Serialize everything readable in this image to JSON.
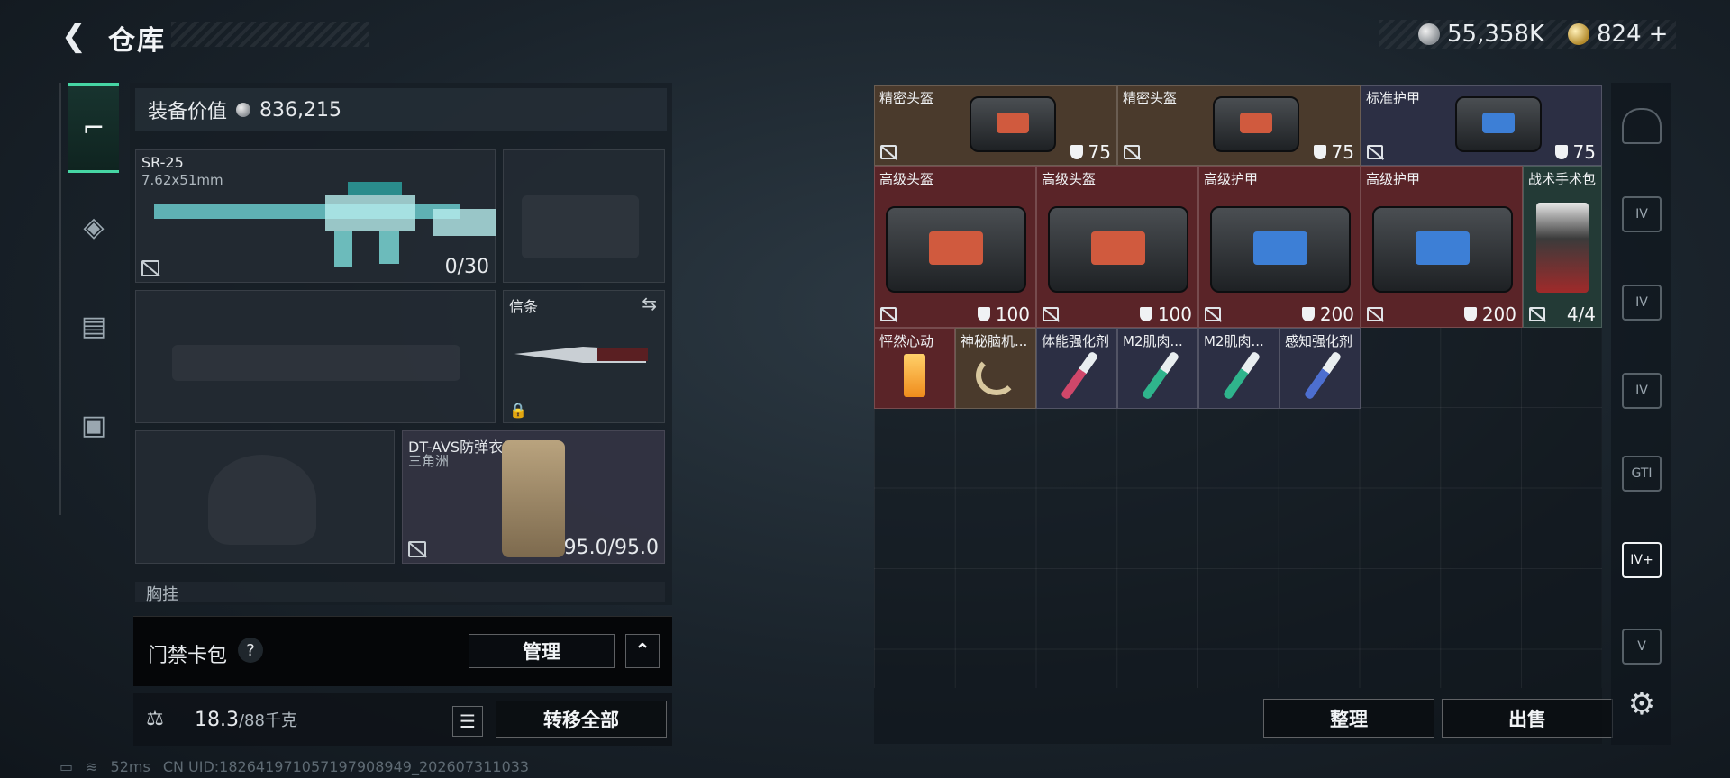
{
  "header": {
    "back_glyph": "❮",
    "title": "仓库",
    "currency_silver": "55,358K",
    "currency_gold": "824",
    "currency_gold_plus": "+"
  },
  "left": {
    "value_label": "装备价值",
    "value_amount": "836,215",
    "weapon_name": "SR-25",
    "weapon_caliber": "7.62x51mm",
    "weapon_ammo": "0/30",
    "melee_label": "信条",
    "armor_name": "DT-AVS防弹衣",
    "armor_map": "三角洲",
    "armor_durability": "95.0/95.0",
    "chest_label": "胸挂",
    "keycard_label": "门禁卡包",
    "help_glyph": "?",
    "manage_label": "管理",
    "collapse_glyph": "⌃",
    "weight_current": "18.3",
    "weight_max": "/88千克",
    "transfer_label": "转移全部",
    "list_glyph": "☰"
  },
  "status": {
    "ping": "52ms",
    "uid": "CN UID:1826419710571979089​49_202607311033"
  },
  "stash": {
    "items": [
      {
        "name": "精密头盔",
        "value": "75",
        "color": "#4a3a2c"
      },
      {
        "name": "精密头盔",
        "value": "75",
        "color": "#4a3a2c"
      },
      {
        "name": "标准护甲",
        "value": "75",
        "color": "#2c2f44"
      },
      {
        "name": "高级头盔",
        "value": "100",
        "color": "#5a2428"
      },
      {
        "name": "高级头盔",
        "value": "100",
        "color": "#5a2428"
      },
      {
        "name": "高级护甲",
        "value": "200",
        "color": "#5a2428"
      },
      {
        "name": "高级护甲",
        "value": "200",
        "color": "#5a2428"
      },
      {
        "name": "战术手术包",
        "value": "4/4",
        "color": "#233a36"
      },
      {
        "name": "怦然心动",
        "value": "",
        "color": "#5a2428"
      },
      {
        "name": "神秘脑机...",
        "value": "",
        "color": "#4a3a2c"
      },
      {
        "name": "体能强化剂",
        "value": "",
        "color": "#2c2f44"
      },
      {
        "name": "M2肌肉...",
        "value": "",
        "color": "#2c2f44"
      },
      {
        "name": "M2肌肉...",
        "value": "",
        "color": "#2c2f44"
      },
      {
        "name": "感知强化剂",
        "value": "",
        "color": "#2c2f44"
      }
    ],
    "sort_label": "整理",
    "sell_label": "出售"
  },
  "icons": {
    "gear": "⚙",
    "lock": "🔒"
  },
  "colors": {
    "accent_green": "#46d6a4",
    "rarity_red": "#5a2428",
    "rarity_gold": "#4a3a2c",
    "rarity_blue": "#2c2f44",
    "rarity_green": "#233a36"
  }
}
